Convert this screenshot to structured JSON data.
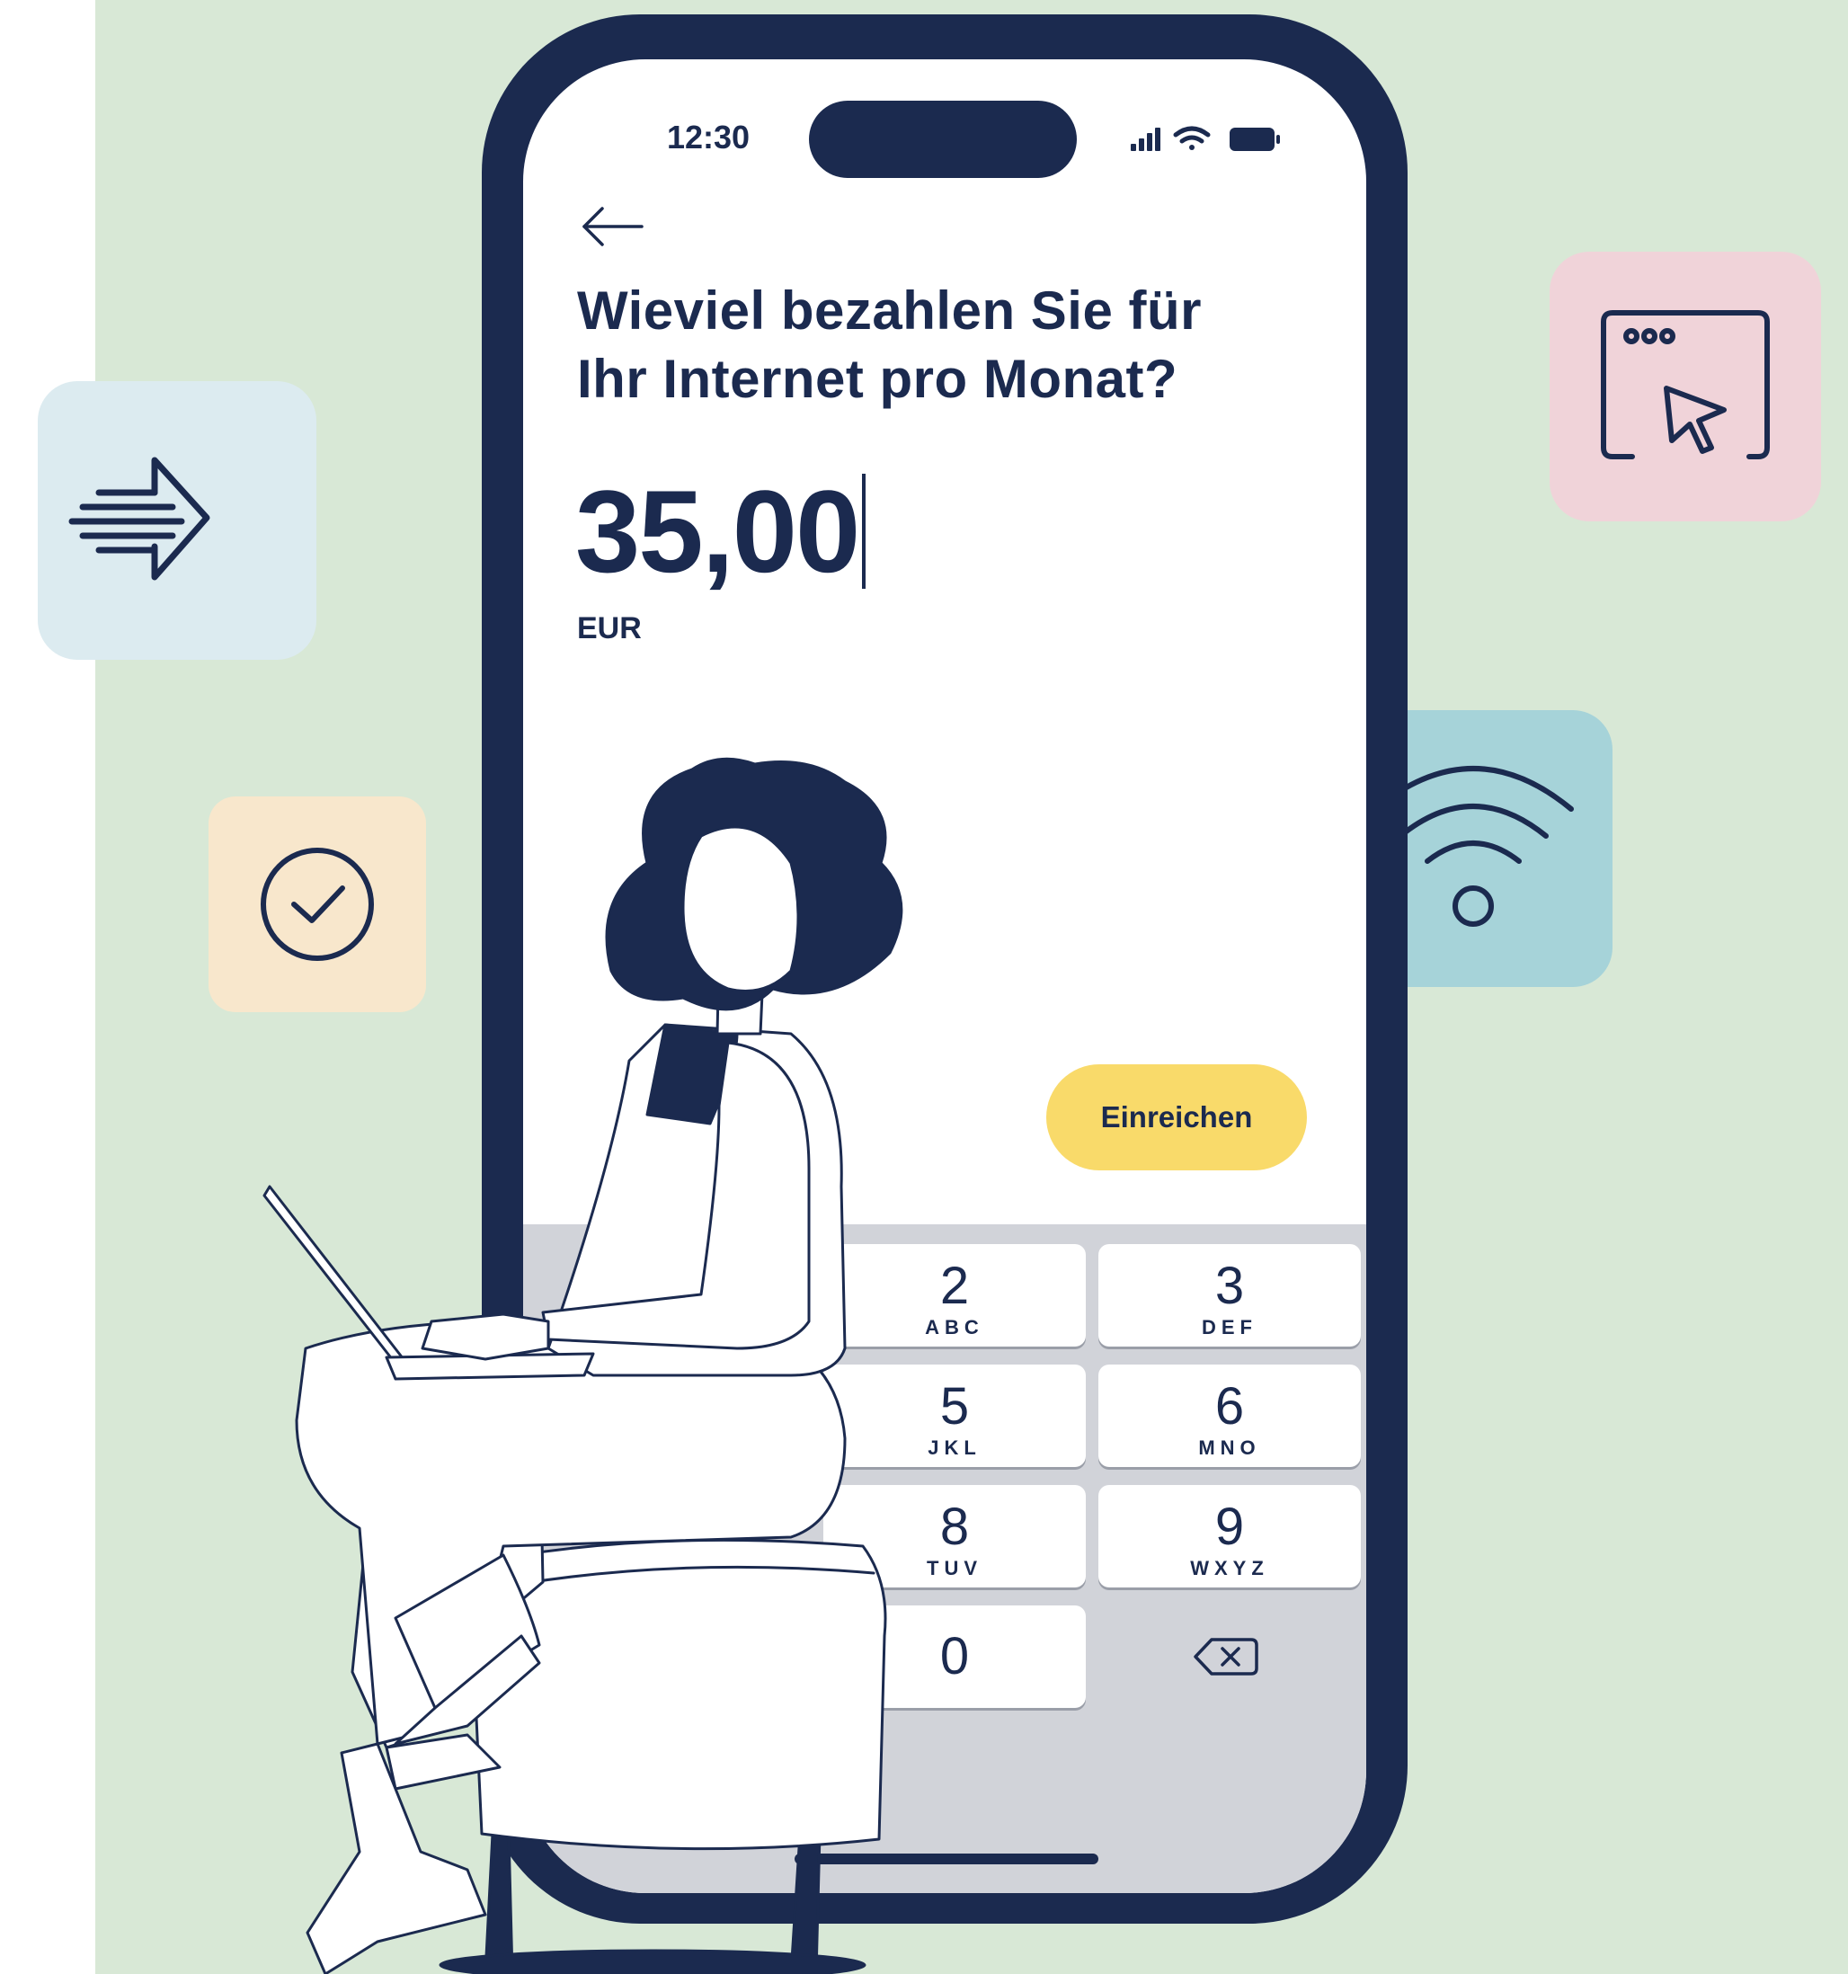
{
  "status_bar": {
    "time": "12:30",
    "icons": [
      "signal-bars-icon",
      "wifi-icon",
      "battery-icon"
    ]
  },
  "screen": {
    "back_icon": "arrow-left-icon",
    "question_line1": "Wieviel bezahlen Sie für",
    "question_line2": "Ihr Internet pro Monat?",
    "amount": "35,00",
    "currency": "EUR",
    "submit_label": "Einreichen"
  },
  "keypad": {
    "keys": [
      {
        "digit": "2",
        "letters": "ABC"
      },
      {
        "digit": "3",
        "letters": "DEF"
      },
      {
        "digit": "5",
        "letters": "JKL"
      },
      {
        "digit": "6",
        "letters": "MNO"
      },
      {
        "digit": "8",
        "letters": "TUV"
      },
      {
        "digit": "9",
        "letters": "WXYZ"
      },
      {
        "digit": "0",
        "letters": ""
      }
    ],
    "delete_icon": "backspace-icon"
  },
  "decor": {
    "tiles": [
      "fast-forward-arrow-icon",
      "checkmark-circle-icon",
      "browser-cursor-icon",
      "wifi-icon"
    ],
    "colors": {
      "background": "#d8e8d6",
      "navy": "#1b2a4f",
      "submit": "#f9da6a",
      "keyboard": "#d1d3d9"
    }
  }
}
